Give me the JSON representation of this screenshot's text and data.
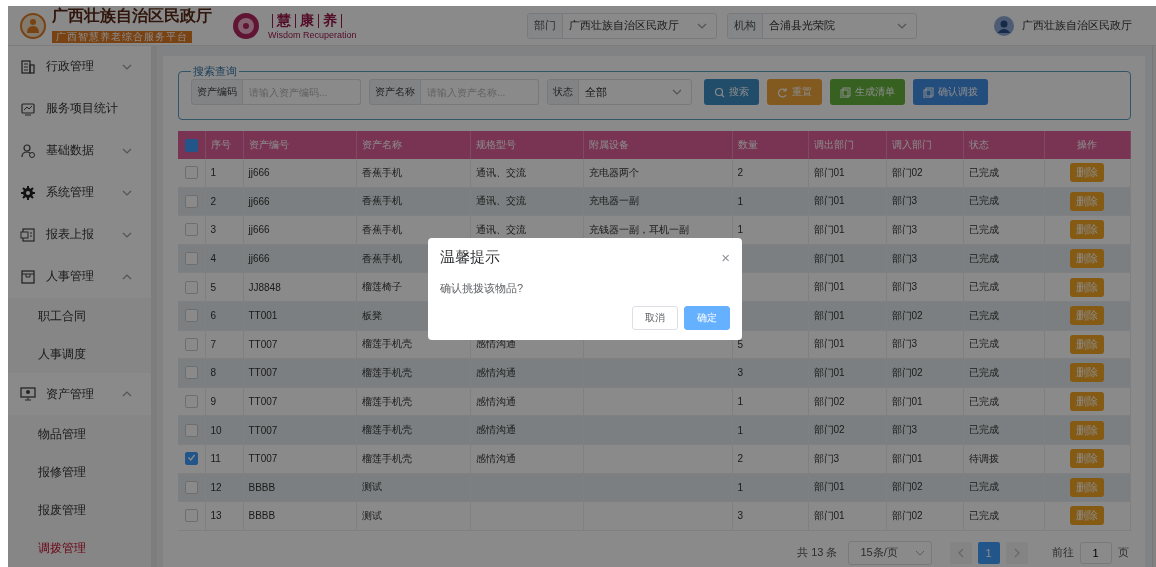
{
  "header": {
    "org_title": "广西壮族自治区民政厅",
    "org_subtitle": "广西智慧养老综合服务平台",
    "brand_chars": [
      "慧",
      "康",
      "养"
    ],
    "brand_tagline": "Wisdom Recuperation",
    "selects": [
      {
        "label": "部门",
        "value": "广西壮族自治区民政厅"
      },
      {
        "label": "机构",
        "value": "合浦县光荣院"
      }
    ],
    "user": "广西壮族自治区民政厅"
  },
  "sidebar": {
    "items": [
      {
        "label": "行政管理",
        "expanded": false
      },
      {
        "label": "服务项目统计"
      },
      {
        "label": "基础数据",
        "expanded": false
      },
      {
        "label": "系统管理",
        "expanded": false
      },
      {
        "label": "报表上报",
        "expanded": false
      },
      {
        "label": "人事管理",
        "expanded": true,
        "children": [
          {
            "label": "职工合同",
            "selected": false
          },
          {
            "label": "人事调度",
            "selected": false
          }
        ]
      },
      {
        "label": "资产管理",
        "expanded": true,
        "children": [
          {
            "label": "物品管理",
            "selected": false
          },
          {
            "label": "报修管理",
            "selected": false
          },
          {
            "label": "报废管理",
            "selected": false
          },
          {
            "label": "调拨管理",
            "selected": true
          }
        ]
      }
    ]
  },
  "search": {
    "legend": "搜索查询",
    "fields": [
      {
        "kind": "input",
        "label": "资产编码",
        "placeholder": "请输入资产编码..."
      },
      {
        "kind": "input",
        "label": "资产名称",
        "placeholder": "请输入资产名称..."
      },
      {
        "kind": "select",
        "label": "状态",
        "value": "全部"
      }
    ],
    "buttons": [
      {
        "label": "搜索"
      },
      {
        "label": "重置"
      },
      {
        "label": "生成清单"
      },
      {
        "label": "确认调拨"
      }
    ]
  },
  "table": {
    "select_all_checked": true,
    "columns": [
      "序号",
      "资产编号",
      "资产名称",
      "规格型号",
      "附属设备",
      "数量",
      "调出部门",
      "调入部门",
      "状态",
      "操作"
    ],
    "rows": [
      {
        "checked": false,
        "cells": [
          "1",
          "jj666",
          "香蕉手机",
          "通讯、交流",
          "充电器两个",
          "2",
          "部门01",
          "部门02",
          "已完成"
        ],
        "action": "删除"
      },
      {
        "checked": false,
        "cells": [
          "2",
          "jj666",
          "香蕉手机",
          "通讯、交流",
          "充电器一副",
          "1",
          "部门01",
          "部门3",
          "已完成"
        ],
        "action": "删除"
      },
      {
        "checked": false,
        "cells": [
          "3",
          "jj666",
          "香蕉手机",
          "通讯、交流",
          "充钱器一副，耳机一副",
          "1",
          "部门01",
          "部门3",
          "已完成"
        ],
        "action": "删除"
      },
      {
        "checked": false,
        "cells": [
          "4",
          "jj666",
          "香蕉手机",
          null,
          null,
          null,
          "部门01",
          "部门3",
          "已完成"
        ],
        "action": "删除"
      },
      {
        "checked": false,
        "cells": [
          "5",
          "JJ8848",
          "榴莲椅子",
          null,
          null,
          null,
          "部门01",
          "部门3",
          "已完成"
        ],
        "action": "删除"
      },
      {
        "checked": false,
        "cells": [
          "6",
          "TT001",
          "板凳",
          null,
          null,
          null,
          "部门01",
          "部门02",
          "已完成"
        ],
        "action": "删除"
      },
      {
        "checked": false,
        "cells": [
          "7",
          "TT007",
          "榴莲手机壳",
          "感情沟通",
          null,
          "5",
          "部门01",
          "部门3",
          "已完成"
        ],
        "action": "删除"
      },
      {
        "checked": false,
        "cells": [
          "8",
          "TT007",
          "榴莲手机壳",
          "感情沟通",
          null,
          "3",
          "部门01",
          "部门02",
          "已完成"
        ],
        "action": "删除"
      },
      {
        "checked": false,
        "cells": [
          "9",
          "TT007",
          "榴莲手机壳",
          "感情沟通",
          null,
          "1",
          "部门02",
          "部门01",
          "已完成"
        ],
        "action": "删除"
      },
      {
        "checked": false,
        "cells": [
          "10",
          "TT007",
          "榴莲手机壳",
          "感情沟通",
          null,
          "1",
          "部门02",
          "部门3",
          "已完成"
        ],
        "action": "删除"
      },
      {
        "checked": true,
        "cells": [
          "11",
          "TT007",
          "榴莲手机壳",
          "感情沟通",
          null,
          "2",
          "部门3",
          "部门01",
          "待调拨"
        ],
        "action": "删除"
      },
      {
        "checked": false,
        "cells": [
          "12",
          "BBBB",
          "测试",
          null,
          null,
          "1",
          "部门01",
          "部门02",
          "已完成"
        ],
        "action": "删除"
      },
      {
        "checked": false,
        "cells": [
          "13",
          "BBBB",
          "测试",
          null,
          null,
          "3",
          "部门01",
          "部门02",
          "已完成"
        ],
        "action": "删除"
      }
    ]
  },
  "pagination": {
    "total": "共 13 条",
    "page_size": "15条/页",
    "pages": [
      {
        "label": "1",
        "selected": true
      }
    ],
    "goto_label": "前往",
    "goto_value": "1",
    "goto_unit": "页"
  },
  "dialog": {
    "title": "温馨提示",
    "close": "×",
    "message": "确认挑拨该物品?",
    "buttons": [
      {
        "label": "取消",
        "kind": "secondary"
      },
      {
        "label": "确定",
        "kind": "primary"
      }
    ]
  }
}
